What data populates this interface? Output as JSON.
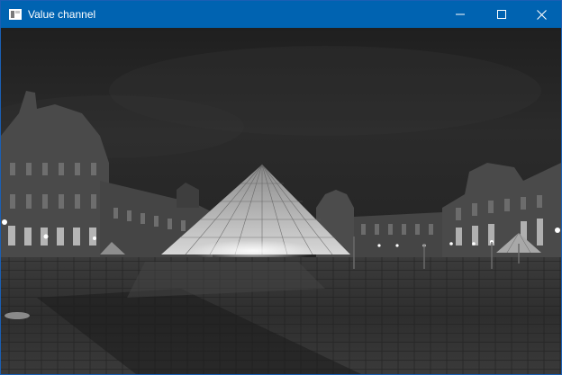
{
  "window": {
    "title": "Value channel",
    "app_icon": "app-window-icon",
    "controls": {
      "minimize_icon": "minimize-icon",
      "maximize_icon": "maximize-icon",
      "close_icon": "close-icon"
    },
    "accent_color": "#0063b1"
  },
  "image": {
    "description_icon": "grayscale-photo",
    "channel_mode": "grayscale"
  }
}
